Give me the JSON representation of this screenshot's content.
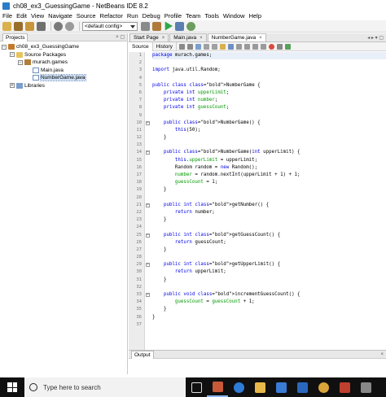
{
  "window": {
    "title": "ch08_ex3_GuessingGame - NetBeans IDE 8.2"
  },
  "menu": [
    "File",
    "Edit",
    "View",
    "Navigate",
    "Source",
    "Refactor",
    "Run",
    "Debug",
    "Profile",
    "Team",
    "Tools",
    "Window",
    "Help"
  ],
  "toolbar": {
    "config_value": "<default config>"
  },
  "projects_panel": {
    "tab_label": "Projects",
    "controls": "× ▢",
    "tree": [
      {
        "label": "ch08_ex3_GuessingGame",
        "indent": 0,
        "toggle": "−",
        "icon": "project-icon"
      },
      {
        "label": "Source Packages",
        "indent": 1,
        "toggle": "−",
        "icon": "folder-icon"
      },
      {
        "label": "murach.games",
        "indent": 2,
        "toggle": "−",
        "icon": "package-icon"
      },
      {
        "label": "Main.java",
        "indent": 3,
        "toggle": "",
        "icon": "java-file-icon"
      },
      {
        "label": "NumberGame.java",
        "indent": 3,
        "toggle": "",
        "icon": "java-file-icon",
        "selected": true
      },
      {
        "label": "Libraries",
        "indent": 1,
        "toggle": "+",
        "icon": "library-icon"
      }
    ]
  },
  "editor": {
    "tabs": [
      {
        "label": "Start Page",
        "active": false
      },
      {
        "label": "Main.java",
        "active": false
      },
      {
        "label": "NumberGame.java",
        "active": true
      }
    ],
    "tab_controls": "◂ ▸ ▾ ▢",
    "view_tabs": {
      "source": "Source",
      "history": "History"
    },
    "line_numbers": [
      "1",
      "2",
      "3",
      "4",
      "5",
      "6",
      "7",
      "8",
      "9",
      "10",
      "11",
      "12",
      "13",
      "14",
      "15",
      "16",
      "17",
      "18",
      "19",
      "20",
      "21",
      "22",
      "23",
      "24",
      "25",
      "26",
      "27",
      "28",
      "29",
      "30",
      "31",
      "32",
      "33",
      "34",
      "35",
      "36",
      "37"
    ],
    "lines": [
      "package murach.games;",
      "",
      "import java.util.Random;",
      "",
      "public class NumberGame {",
      "    private int upperLimit;",
      "    private int number;",
      "    private int guessCount;",
      "",
      "    public NumberGame() {",
      "        this(50);",
      "    }",
      "",
      "    public NumberGame(int upperLimit) {",
      "        this.upperLimit = upperLimit;",
      "        Random random = new Random();",
      "        number = random.nextInt(upperLimit + 1) + 1;",
      "        guessCount = 1;",
      "    }",
      "",
      "    public int getNumber() {",
      "        return number;",
      "    }",
      "",
      "    public int getGuessCount() {",
      "        return guessCount;",
      "    }",
      "",
      "    public int getUpperLimit() {",
      "        return upperLimit;",
      "    }",
      "",
      "    public void incrementGuessCount() {",
      "        guessCount = guessCount + 1;",
      "    }",
      "}",
      ""
    ],
    "fold_lines": [
      10,
      14,
      21,
      25,
      29,
      33
    ]
  },
  "output_panel": {
    "tab_label": "Output",
    "controls": "×"
  },
  "taskbar": {
    "search_placeholder": "Type here to search"
  }
}
